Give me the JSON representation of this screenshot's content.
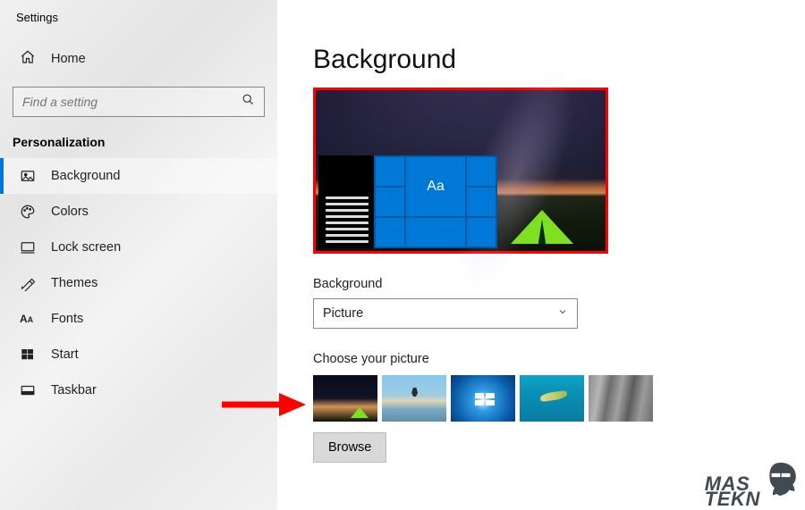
{
  "app": {
    "title": "Settings"
  },
  "sidebar": {
    "home_label": "Home",
    "search_placeholder": "Find a setting",
    "section_label": "Personalization",
    "items": [
      {
        "label": "Background",
        "active": true
      },
      {
        "label": "Colors"
      },
      {
        "label": "Lock screen"
      },
      {
        "label": "Themes"
      },
      {
        "label": "Fonts"
      },
      {
        "label": "Start"
      },
      {
        "label": "Taskbar"
      }
    ]
  },
  "main": {
    "page_title": "Background",
    "preview_sample_text": "Aa",
    "dropdown_label": "Background",
    "dropdown_value": "Picture",
    "thumbs_label": "Choose your picture",
    "browse_label": "Browse"
  },
  "watermark": {
    "line1": "MAS",
    "line2": "TEKN"
  }
}
